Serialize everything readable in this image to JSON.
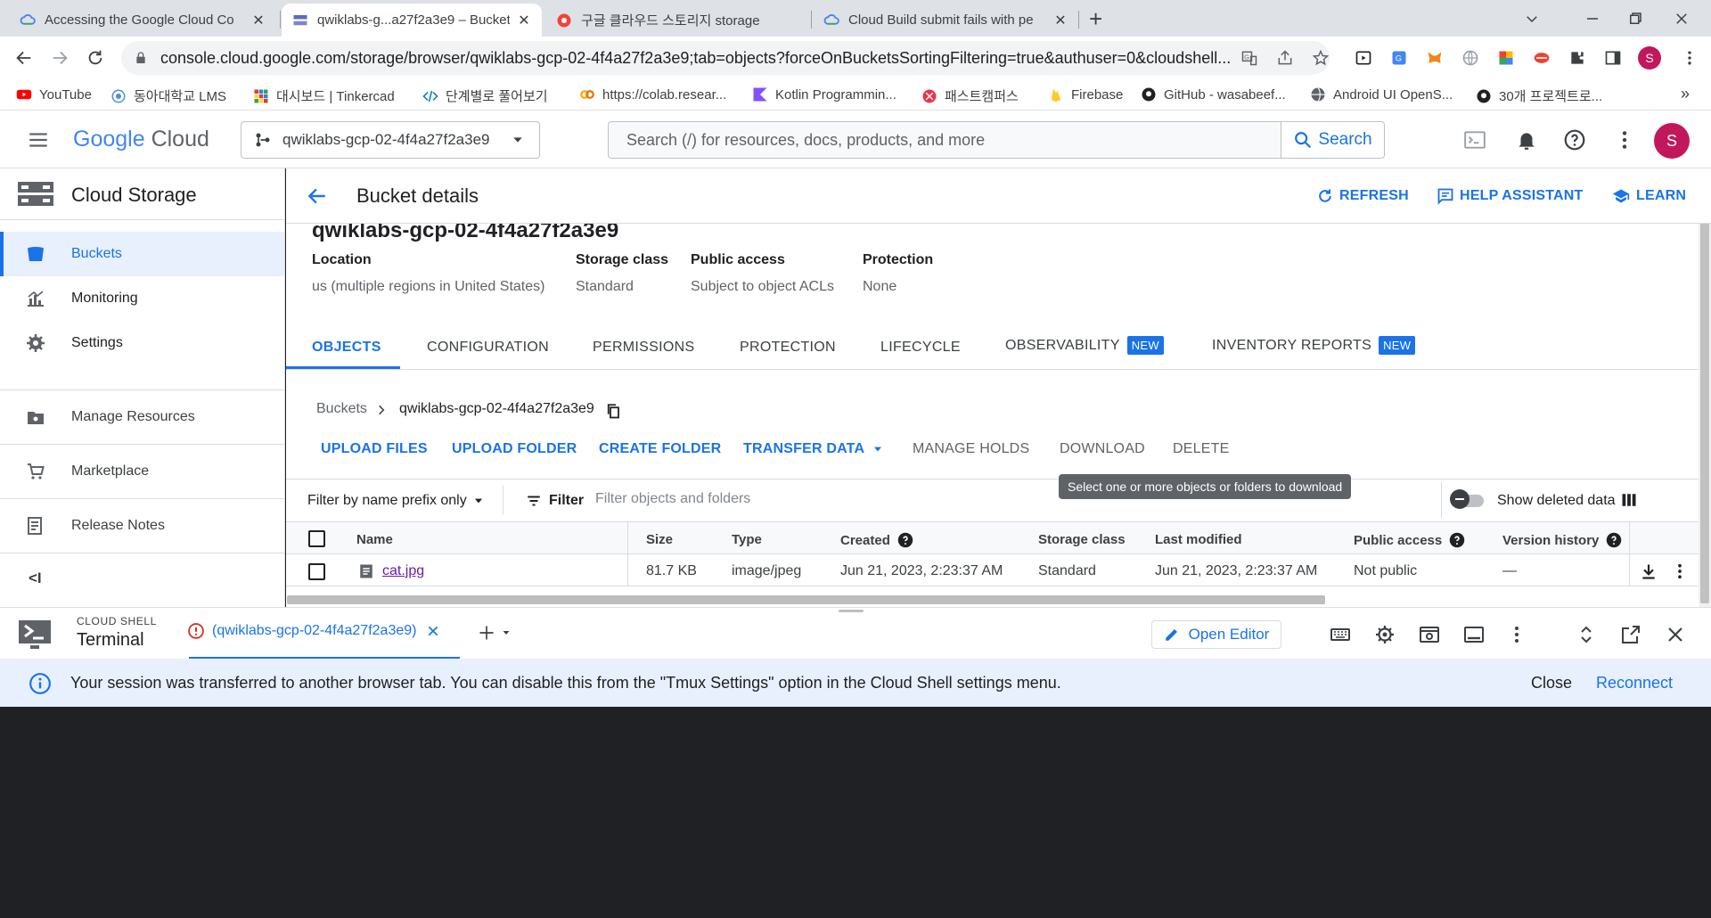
{
  "browser": {
    "tabs": [
      {
        "title": "Accessing the Google Cloud Co",
        "active": false
      },
      {
        "title": "qwiklabs-g...a27f2a3e9 – Bucket",
        "active": true
      },
      {
        "title": "구글 클라우드 스토리지 storage",
        "active": false
      },
      {
        "title": "Cloud Build submit fails with pe",
        "active": false
      }
    ],
    "new_tab": "+",
    "url": "console.cloud.google.com/storage/browser/qwiklabs-gcp-02-4f4a27f2a3e9;tab=objects?forceOnBucketsSortingFiltering=true&authuser=0&cloudshell...",
    "profile_initial": "S",
    "bookmarks": [
      "YouTube",
      "동아대학교 LMS",
      "대시보드 | Tinkercad",
      "단계별로 풀어보기",
      "https://colab.resear...",
      "Kotlin Programmin...",
      "패스트캠퍼스",
      "Firebase",
      "GitHub - wasabeef...",
      "Android UI OpenS...",
      "30개 프로젝트로..."
    ],
    "bookmarks_more": "»"
  },
  "header": {
    "logo_google": "Google",
    "logo_cloud": "Cloud",
    "project": "qwiklabs-gcp-02-4f4a27f2a3e9",
    "search_placeholder": "Search (/) for resources, docs, products, and more",
    "search_button": "Search",
    "avatar": "S"
  },
  "sidebar": {
    "title": "Cloud Storage",
    "items": [
      {
        "label": "Buckets",
        "active": true
      },
      {
        "label": "Monitoring"
      },
      {
        "label": "Settings"
      }
    ],
    "sections": [
      {
        "label": "Manage Resources"
      },
      {
        "label": "Marketplace"
      },
      {
        "label": "Release Notes"
      }
    ],
    "collapse": "<I"
  },
  "page": {
    "title": "Bucket details",
    "actions": {
      "refresh": "REFRESH",
      "help": "HELP ASSISTANT",
      "learn": "LEARN"
    },
    "bucket_name_partial": "qwiklabs-gcp-02-4f4a27f2a3e9",
    "info": [
      {
        "label": "Location",
        "value": "us (multiple regions in United States)"
      },
      {
        "label": "Storage class",
        "value": "Standard"
      },
      {
        "label": "Public access",
        "value": "Subject to object ACLs"
      },
      {
        "label": "Protection",
        "value": "None"
      }
    ],
    "tabs": [
      {
        "label": "OBJECTS",
        "active": true
      },
      {
        "label": "CONFIGURATION"
      },
      {
        "label": "PERMISSIONS"
      },
      {
        "label": "PROTECTION"
      },
      {
        "label": "LIFECYCLE"
      },
      {
        "label": "OBSERVABILITY",
        "badge": "NEW"
      },
      {
        "label": "INVENTORY REPORTS",
        "badge": "NEW"
      }
    ],
    "breadcrumb": {
      "root": "Buckets",
      "current": "qwiklabs-gcp-02-4f4a27f2a3e9"
    },
    "object_actions": {
      "upload_files": "UPLOAD FILES",
      "upload_folder": "UPLOAD FOLDER",
      "create_folder": "CREATE FOLDER",
      "transfer_data": "TRANSFER DATA",
      "manage_holds": "MANAGE HOLDS",
      "download": "DOWNLOAD",
      "delete": "DELETE"
    },
    "tooltip": "Select one or more objects or folders to download",
    "filter": {
      "mode": "Filter by name prefix only",
      "label": "Filter",
      "placeholder": "Filter objects and folders",
      "show_deleted": "Show deleted data"
    },
    "table": {
      "columns": [
        "Name",
        "Size",
        "Type",
        "Created",
        "Storage class",
        "Last modified",
        "Public access",
        "Version history"
      ],
      "rows": [
        {
          "name": "cat.jpg",
          "size": "81.7 KB",
          "type": "image/jpeg",
          "created": "Jun 21, 2023, 2:23:37 AM",
          "storage_class": "Standard",
          "last_modified": "Jun 21, 2023, 2:23:37 AM",
          "public_access": "Not public",
          "version_history": "—"
        }
      ]
    }
  },
  "cloud_shell": {
    "label": "CLOUD SHELL",
    "terminal": "Terminal",
    "session_tab": "(qwiklabs-gcp-02-4f4a27f2a3e9)",
    "open_editor": "Open Editor",
    "banner_message": "Your session was transferred to another browser tab. You can disable this from the \"Tmux Settings\" option in the Cloud Shell settings menu.",
    "close": "Close",
    "reconnect": "Reconnect"
  }
}
